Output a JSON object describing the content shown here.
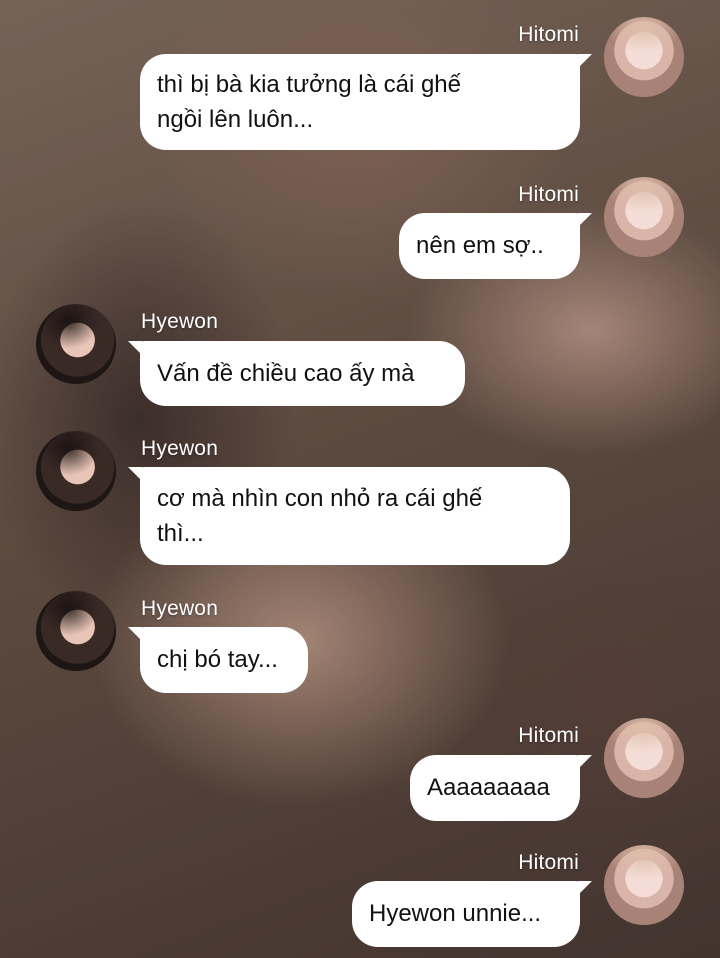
{
  "messages": [
    {
      "sender": "Hitomi",
      "side": "right",
      "text": "thì bị bà kia tưởng là cái ghế\nngồi lên luôn..."
    },
    {
      "sender": "Hitomi",
      "side": "right",
      "text": "nên em sợ.."
    },
    {
      "sender": "Hyewon",
      "side": "left",
      "text": "Vấn đề chiều cao ấy mà"
    },
    {
      "sender": "Hyewon",
      "side": "left",
      "text": "cơ mà nhìn con nhỏ ra cái ghế\nthì..."
    },
    {
      "sender": "Hyewon",
      "side": "left",
      "text": "chị bó tay..."
    },
    {
      "sender": "Hitomi",
      "side": "right",
      "text": "Aaaaaaaaa"
    },
    {
      "sender": "Hitomi",
      "side": "right",
      "text": "Hyewon unnie..."
    }
  ],
  "colors": {
    "bubble": "#ffffff",
    "text": "#111111",
    "name": "#ffffff"
  }
}
